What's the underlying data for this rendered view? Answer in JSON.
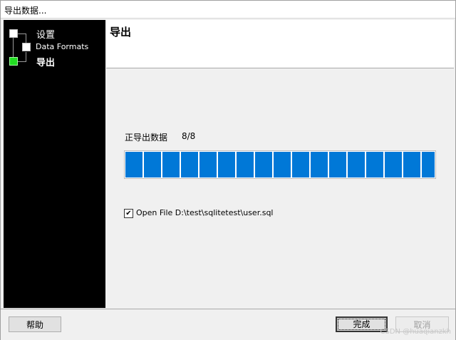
{
  "window": {
    "title": "导出数据..."
  },
  "sidebar": {
    "items": [
      {
        "label": "设置",
        "level": 1,
        "state": "done"
      },
      {
        "label": "Data Formats",
        "level": 2,
        "state": "done"
      },
      {
        "label": "导出",
        "level": 1,
        "state": "current"
      }
    ]
  },
  "header": {
    "title": "导出"
  },
  "progress": {
    "label": "正导出数据",
    "count": "8/8",
    "fraction": 1.0,
    "color": "#0078d7"
  },
  "option": {
    "checked": true,
    "check_mark": "✔",
    "label": "Open File D:\\test\\sqlitetest\\user.sql"
  },
  "footer": {
    "help_label": "帮助",
    "finish_label": "完成",
    "cancel_label": "取消",
    "watermark": "CSDN @huaqianzkh"
  },
  "colors": {
    "active_step": "#22dd22",
    "sidebar_bg": "#000000"
  }
}
